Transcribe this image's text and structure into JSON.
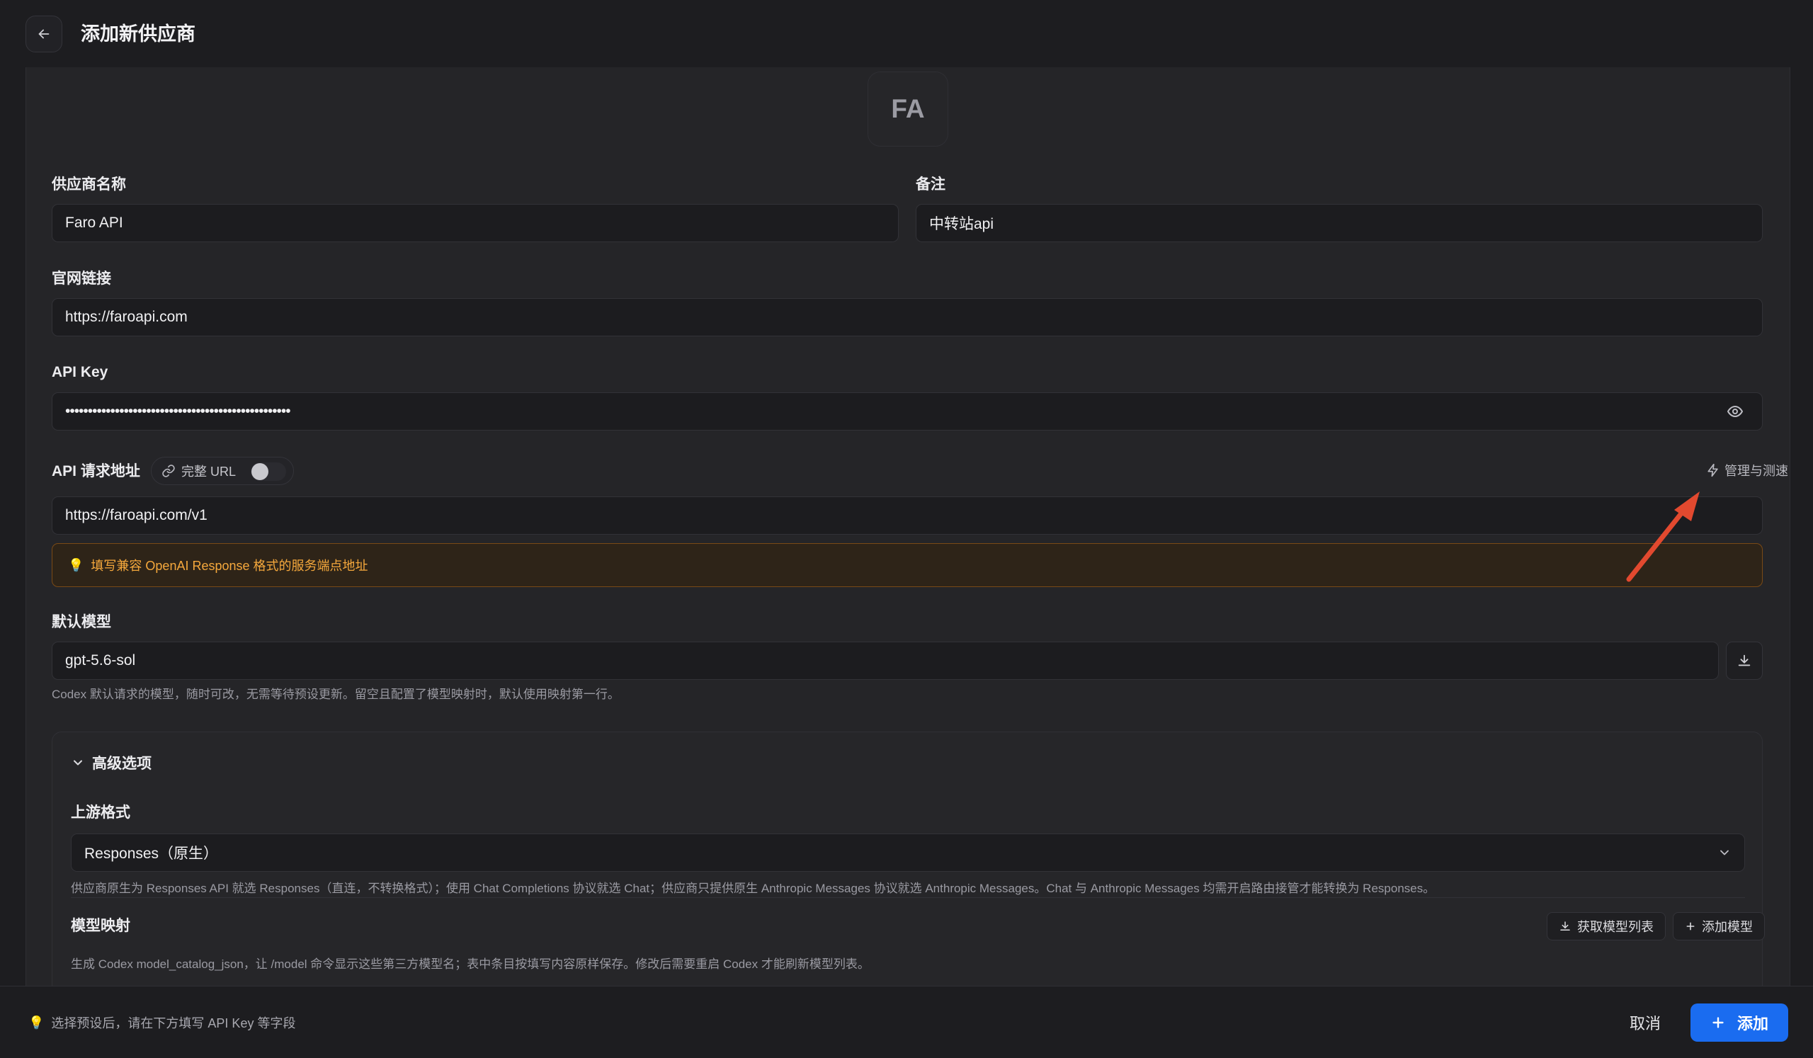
{
  "header": {
    "back_icon": "arrow-left-icon",
    "title": "添加新供应商"
  },
  "avatar": {
    "initials": "FA"
  },
  "form": {
    "provider_name": {
      "label": "供应商名称",
      "value": "Faro API"
    },
    "note": {
      "label": "备注",
      "value": "中转站api"
    },
    "website": {
      "label": "官网链接",
      "value": "https://faroapi.com"
    },
    "api_key": {
      "label": "API Key",
      "value": "••••••••••••••••••••••••••••••••••••••••••••••••••",
      "toggle_icon": "eye-icon"
    },
    "api_url": {
      "label": "API 请求地址",
      "full_url_label": "完整 URL",
      "full_url_enabled": false,
      "manage_label": "管理与测速",
      "value": "https://faroapi.com/v1",
      "warning": "填写兼容 OpenAI Response 格式的服务端点地址"
    },
    "default_model": {
      "label": "默认模型",
      "value": "gpt-5.6-sol",
      "hint": "Codex 默认请求的模型，随时可改，无需等待预设更新。留空且配置了模型映射时，默认使用映射第一行。"
    }
  },
  "advanced": {
    "title": "高级选项",
    "expanded": true,
    "upstream": {
      "label": "上游格式",
      "value": "Responses（原生）",
      "hint": "供应商原生为 Responses API 就选 Responses（直连，不转换格式）；使用 Chat Completions 协议就选 Chat；供应商只提供原生 Anthropic Messages 协议就选 Anthropic Messages。Chat 与 Anthropic Messages 均需开启路由接管才能转换为 Responses。"
    },
    "model_mapping": {
      "label": "模型映射",
      "fetch_label": "获取模型列表",
      "add_label": "添加模型",
      "hint": "生成 Codex model_catalog_json，让 /model 命令显示这些第三方模型名；表中条目按填写内容原样保存。修改后需要重启 Codex 才能刷新模型列表。"
    }
  },
  "footer": {
    "hint": "选择预设后，请在下方填写 API Key 等字段",
    "cancel_label": "取消",
    "add_label": "添加"
  },
  "colors": {
    "accent": "#1a6cf0",
    "warning": "#f5a83c",
    "annotation": "#e2492f"
  }
}
